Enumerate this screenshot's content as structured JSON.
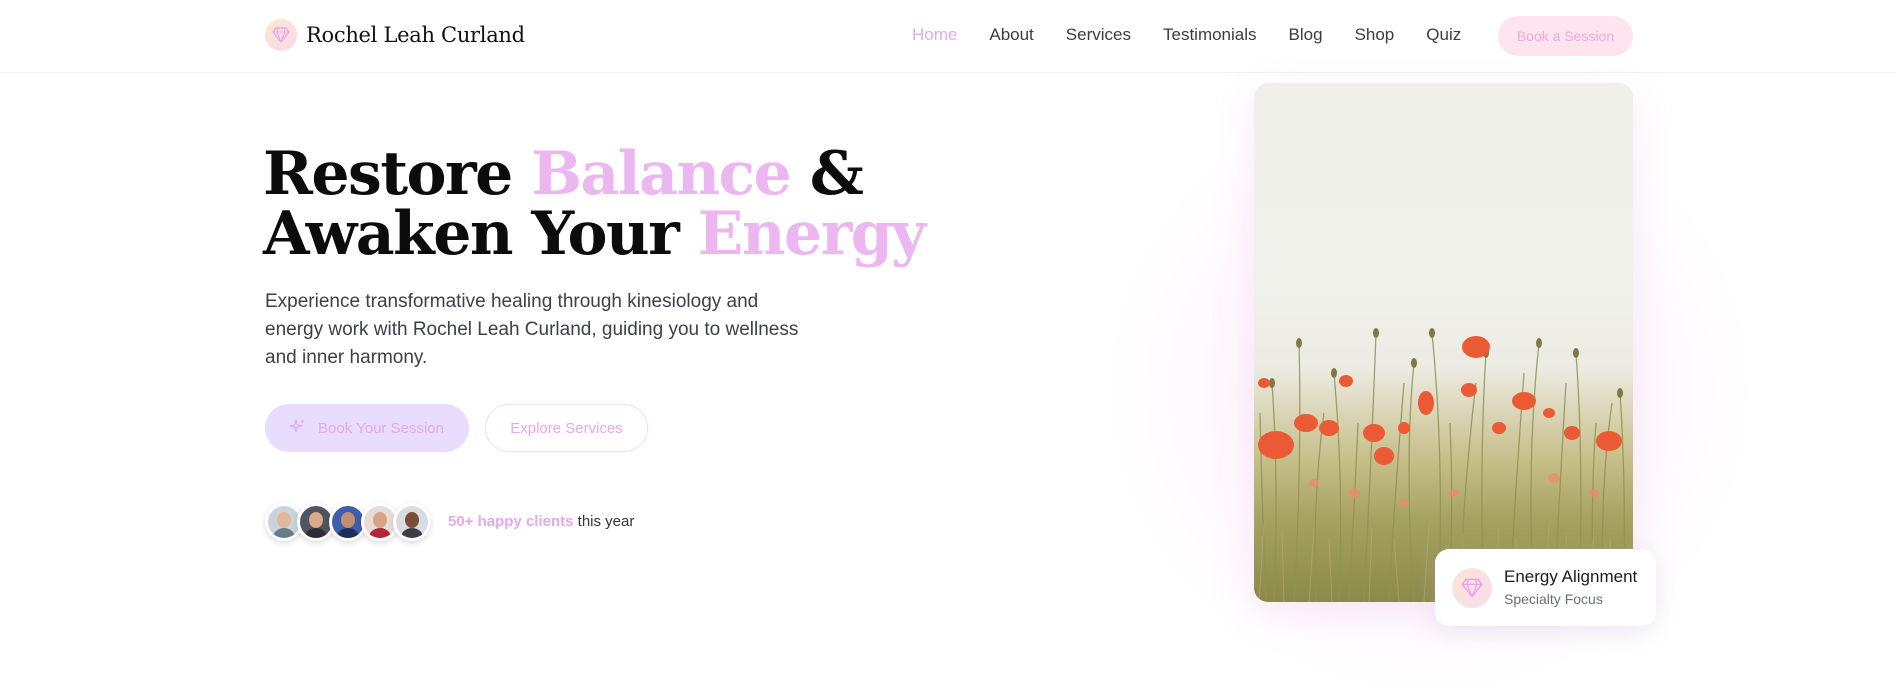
{
  "brand": {
    "name": "Rochel Leah Curland",
    "logo_icon": "diamond-icon"
  },
  "nav": {
    "items": [
      {
        "label": "Home",
        "active": true
      },
      {
        "label": "About",
        "active": false
      },
      {
        "label": "Services",
        "active": false
      },
      {
        "label": "Testimonials",
        "active": false
      },
      {
        "label": "Blog",
        "active": false
      },
      {
        "label": "Shop",
        "active": false
      },
      {
        "label": "Quiz",
        "active": false
      }
    ],
    "cta_label": "Book a Session"
  },
  "hero": {
    "title_line1_a": "Restore ",
    "title_line1_accent": "Balance",
    "title_line1_b": " &",
    "title_line2_a": "Awaken Your ",
    "title_line2_accent": "Energy",
    "subtitle": "Experience transformative healing through kinesiology and energy work with Rochel Leah Curland, guiding you to wellness and inner harmony.",
    "primary_button": "Book Your Session",
    "primary_icon": "sparkles-icon",
    "secondary_button": "Explore Services",
    "clients_highlight": "50+ happy clients",
    "clients_rest": " this year"
  },
  "feature_card": {
    "title": "Energy Alignment",
    "subtitle": "Specialty Focus",
    "icon": "diamond-icon"
  },
  "colors": {
    "accent": "#ecb6f1",
    "primary_button_bg": "#e8ddfc",
    "nav_cta_bg": "#fde4ee",
    "text_dark": "#0c0c0c"
  }
}
